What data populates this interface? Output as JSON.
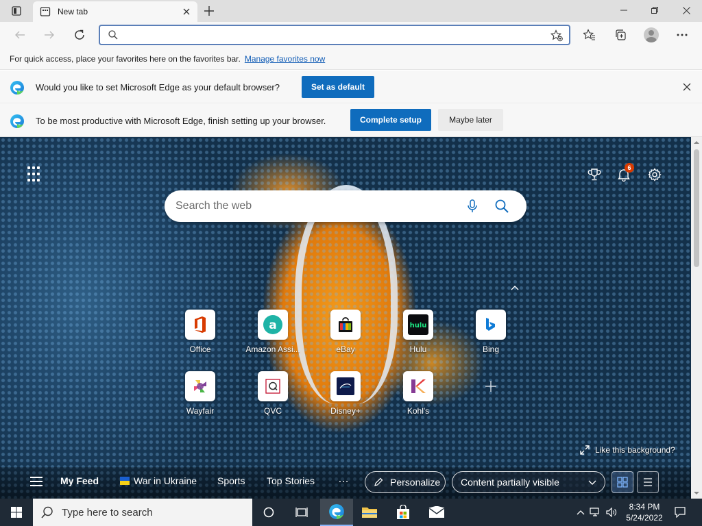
{
  "tab": {
    "title": "New tab"
  },
  "toolbar": {
    "address_placeholder": ""
  },
  "favorites_bar": {
    "message": "For quick access, place your favorites here on the favorites bar.",
    "link": "Manage favorites now"
  },
  "infobar_default": {
    "message": "Would you like to set Microsoft Edge as your default browser?",
    "button": "Set as default"
  },
  "infobar_setup": {
    "message": "To be most productive with Microsoft Edge, finish setting up your browser.",
    "primary_button": "Complete setup",
    "secondary_button": "Maybe later"
  },
  "newtab": {
    "notification_count": "6",
    "search_placeholder": "Search the web",
    "like_background": "Like this background?",
    "quick_links": [
      {
        "label": "Office",
        "icon": "office-icon"
      },
      {
        "label": "Amazon Assi...",
        "icon": "amazon-icon"
      },
      {
        "label": "eBay",
        "icon": "ebay-icon"
      },
      {
        "label": "Hulu",
        "icon": "hulu-icon"
      },
      {
        "label": "Bing",
        "icon": "bing-icon"
      },
      {
        "label": "Wayfair",
        "icon": "wayfair-icon"
      },
      {
        "label": "QVC",
        "icon": "qvc-icon"
      },
      {
        "label": "Disney+",
        "icon": "disney-plus-icon"
      },
      {
        "label": "Kohl's",
        "icon": "kohls-icon"
      }
    ]
  },
  "feed": {
    "my_feed": "My Feed",
    "items": [
      "War in Ukraine",
      "Sports",
      "Top Stories"
    ],
    "more": "…",
    "personalize": "Personalize",
    "visibility": "Content partially visible"
  },
  "taskbar": {
    "search_placeholder": "Type here to search",
    "time": "8:34 PM",
    "date": "5/24/2022"
  },
  "colors": {
    "accent": "#0f6cbd",
    "address_border": "#5b7fb8",
    "notification_badge": "#d83b01",
    "taskbar": "#1f2a36"
  }
}
